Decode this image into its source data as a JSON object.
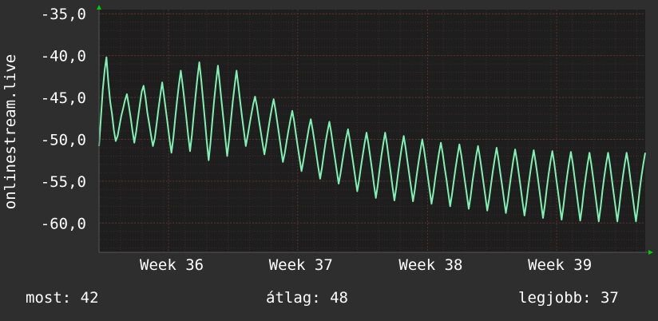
{
  "chart_data": {
    "type": "line",
    "ylabel": "onlinestream.live",
    "ylim": [
      -63.5,
      -34.5
    ],
    "yticks": [
      -35,
      -40,
      -45,
      -50,
      -55,
      -60
    ],
    "ytick_labels": [
      "-35,0",
      "-40,0",
      "-45,0",
      "-50,0",
      "-55,0",
      "-60,0"
    ],
    "xlim": [
      0,
      660
    ],
    "xticks": [
      84,
      240,
      397,
      553
    ],
    "xtick_labels": [
      "Week 36",
      "Week 37",
      "Week 38",
      "Week 39"
    ],
    "grid": true,
    "colors": {
      "background": "#2e2e2e",
      "plot": "#1e1e1e",
      "grid": "#4a2e2e",
      "line": "#7ff2b2",
      "arrow": "#00cc00"
    },
    "series": [
      {
        "values": [
          -50.8,
          -47.5,
          -44.1,
          -41.8,
          -40.2,
          -43.1,
          -45.5,
          -47.0,
          -48.9,
          -50.2,
          -49.6,
          -48.4,
          -47.2,
          -46.3,
          -45.3,
          -44.6,
          -45.9,
          -47.4,
          -49.0,
          -50.4,
          -49.1,
          -47.4,
          -45.8,
          -44.3,
          -43.6,
          -45.0,
          -46.8,
          -48.1,
          -49.5,
          -50.8,
          -49.9,
          -48.2,
          -46.4,
          -44.7,
          -43.2,
          -44.8,
          -46.6,
          -48.3,
          -50.1,
          -51.6,
          -49.8,
          -47.5,
          -45.4,
          -43.5,
          -41.8,
          -43.5,
          -45.4,
          -47.4,
          -49.6,
          -51.4,
          -49.5,
          -47.0,
          -44.7,
          -42.6,
          -40.8,
          -42.9,
          -45.3,
          -47.7,
          -50.2,
          -52.5,
          -50.4,
          -47.8,
          -45.3,
          -43.1,
          -41.2,
          -43.3,
          -45.6,
          -47.7,
          -49.9,
          -52.0,
          -50.0,
          -47.7,
          -45.5,
          -43.6,
          -41.8,
          -43.6,
          -45.5,
          -47.3,
          -49.1,
          -50.8,
          -49.6,
          -48.3,
          -47.0,
          -45.8,
          -44.9,
          -46.1,
          -47.6,
          -49.0,
          -50.4,
          -51.8,
          -50.5,
          -49.0,
          -47.6,
          -46.3,
          -45.2,
          -46.5,
          -48.0,
          -49.6,
          -51.2,
          -52.7,
          -51.6,
          -50.2,
          -48.9,
          -47.7,
          -46.6,
          -47.8,
          -49.4,
          -50.9,
          -52.4,
          -53.8,
          -52.6,
          -51.2,
          -49.9,
          -48.6,
          -47.6,
          -48.9,
          -50.3,
          -51.8,
          -53.3,
          -54.7,
          -53.4,
          -51.8,
          -50.3,
          -49.0,
          -47.9,
          -49.2,
          -50.8,
          -52.3,
          -53.8,
          -55.3,
          -54.1,
          -52.6,
          -51.2,
          -49.9,
          -48.8,
          -50.1,
          -51.6,
          -53.1,
          -54.7,
          -56.2,
          -54.9,
          -53.3,
          -51.8,
          -50.4,
          -49.2,
          -50.5,
          -52.1,
          -53.7,
          -55.4,
          -57.0,
          -55.5,
          -53.7,
          -52.0,
          -50.5,
          -49.2,
          -50.6,
          -52.3,
          -54.0,
          -55.7,
          -57.3,
          -55.8,
          -54.0,
          -52.4,
          -50.9,
          -49.6,
          -51.0,
          -52.6,
          -54.2,
          -55.8,
          -57.4,
          -56.0,
          -54.3,
          -52.7,
          -51.3,
          -50.0,
          -51.3,
          -52.9,
          -54.5,
          -56.1,
          -57.7,
          -56.3,
          -54.6,
          -53.1,
          -51.6,
          -50.4,
          -51.7,
          -53.3,
          -54.8,
          -56.4,
          -58.0,
          -56.6,
          -54.9,
          -53.3,
          -51.9,
          -50.6,
          -51.9,
          -53.5,
          -55.1,
          -56.7,
          -58.3,
          -56.9,
          -55.1,
          -53.5,
          -52.0,
          -50.8,
          -52.1,
          -53.7,
          -55.3,
          -56.9,
          -58.5,
          -57.1,
          -55.4,
          -53.8,
          -52.3,
          -51.0,
          -52.4,
          -54.0,
          -55.6,
          -57.2,
          -58.8,
          -57.4,
          -55.6,
          -54.0,
          -52.5,
          -51.2,
          -52.6,
          -54.2,
          -55.8,
          -57.5,
          -59.1,
          -57.6,
          -55.8,
          -54.1,
          -52.6,
          -51.3,
          -52.7,
          -54.3,
          -56.0,
          -57.7,
          -59.4,
          -57.8,
          -55.9,
          -54.2,
          -52.7,
          -51.4,
          -52.8,
          -54.5,
          -56.2,
          -57.9,
          -59.6,
          -58.0,
          -56.0,
          -54.3,
          -52.8,
          -51.5,
          -52.9,
          -54.6,
          -56.3,
          -58.0,
          -59.7,
          -58.1,
          -56.1,
          -54.4,
          -52.9,
          -51.6,
          -53.0,
          -54.7,
          -56.4,
          -58.1,
          -59.8,
          -58.1,
          -56.1,
          -54.4,
          -52.9,
          -51.6,
          -53.0,
          -54.7,
          -56.4,
          -58.1,
          -59.8,
          -58.1,
          -56.1,
          -54.4,
          -52.9,
          -51.6,
          -53.0,
          -54.7,
          -56.4,
          -58.1,
          -59.8,
          -58.1,
          -56.1,
          -54.4,
          -52.9,
          -51.6
        ],
        "note_unused": ""
      }
    ]
  },
  "footer": {
    "now_label": "most:",
    "now_value": "42",
    "avg_label": "átlag:",
    "avg_value": "48",
    "best_label": "legjobb:",
    "best_value": "37"
  }
}
